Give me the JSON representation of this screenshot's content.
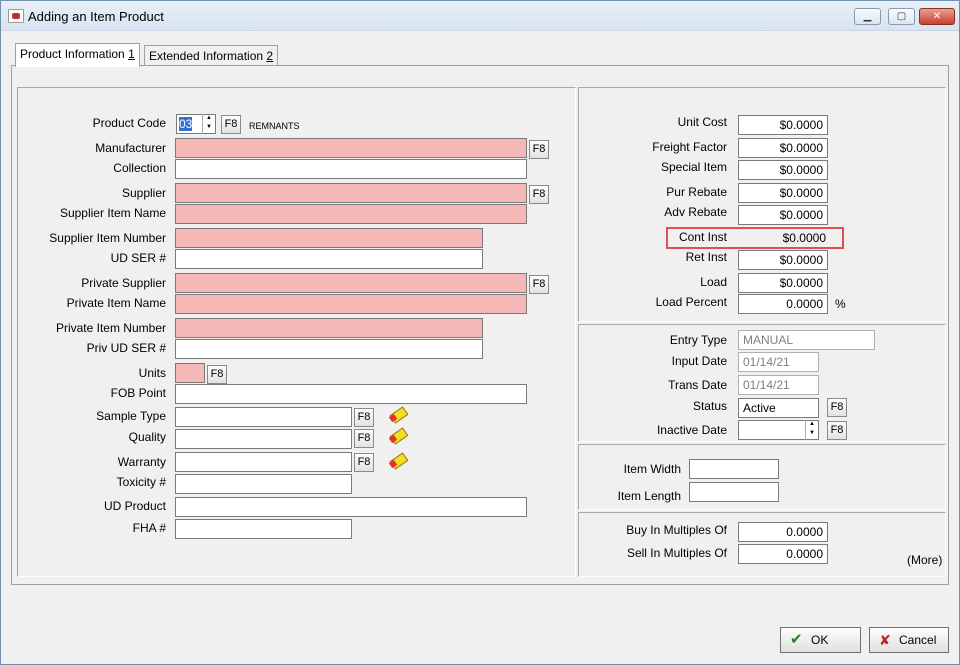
{
  "window": {
    "title": "Adding an Item Product"
  },
  "tabs": [
    {
      "label": "Product Information",
      "key": "1"
    },
    {
      "label": "Extended Information",
      "key": "2"
    }
  ],
  "left": {
    "product_code_label": "Product Code",
    "product_code_value": "03",
    "product_code_desc": "REMNANTS",
    "manufacturer_label": "Manufacturer",
    "collection_label": "Collection",
    "supplier_label": "Supplier",
    "supplier_item_name_label": "Supplier Item Name",
    "supplier_item_number_label": "Supplier Item Number",
    "ud_ser_label": "UD SER #",
    "private_supplier_label": "Private Supplier",
    "private_item_name_label": "Private Item Name",
    "private_item_number_label": "Private Item Number",
    "priv_ud_ser_label": "Priv UD SER #",
    "units_label": "Units",
    "fob_point_label": "FOB Point",
    "sample_type_label": "Sample Type",
    "quality_label": "Quality",
    "warranty_label": "Warranty",
    "toxicity_label": "Toxicity #",
    "ud_product_label": "UD Product",
    "fha_label": "FHA #",
    "f8": "F8"
  },
  "costs": {
    "unit_cost_label": "Unit Cost",
    "unit_cost": "$0.0000",
    "freight_factor_label": "Freight Factor",
    "freight_factor": "$0.0000",
    "special_item_label": "Special Item",
    "special_item": "$0.0000",
    "pur_rebate_label": "Pur Rebate",
    "pur_rebate": "$0.0000",
    "adv_rebate_label": "Adv Rebate",
    "adv_rebate": "$0.0000",
    "cont_inst_label": "Cont Inst",
    "cont_inst": "$0.0000",
    "ret_inst_label": "Ret Inst",
    "ret_inst": "$0.0000",
    "load_label": "Load",
    "load": "$0.0000",
    "load_percent_label": "Load Percent",
    "load_percent": "0.0000",
    "percent_sign": "%"
  },
  "entry": {
    "entry_type_label": "Entry Type",
    "entry_type": "MANUAL",
    "input_date_label": "Input Date",
    "input_date": "01/14/21",
    "trans_date_label": "Trans Date",
    "trans_date": "01/14/21",
    "status_label": "Status",
    "status": "Active",
    "inactive_date_label": "Inactive Date"
  },
  "dims": {
    "item_width_label": "Item Width",
    "item_length_label": "Item Length"
  },
  "multiples": {
    "buy_label": "Buy In Multiples Of",
    "buy": "0.0000",
    "sell_label": "Sell In Multiples Of",
    "sell": "0.0000",
    "more": "(More)"
  },
  "buttons": {
    "ok": "OK",
    "cancel": "Cancel"
  },
  "colors": {
    "required": "#f4b8b8",
    "highlight": "#e05050"
  }
}
